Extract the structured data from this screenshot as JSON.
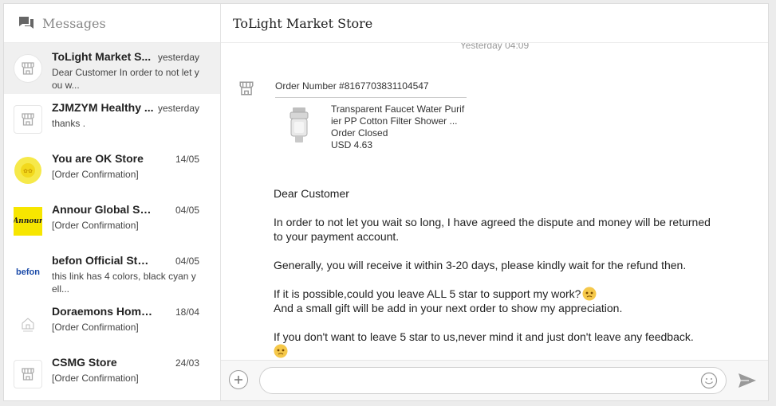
{
  "sidebar": {
    "title": "Messages",
    "icon": "chat-bubbles-icon",
    "conversations": [
      {
        "name": "ToLight Market S...",
        "date": "yesterday",
        "preview": "Dear Customer In order to not let you w...",
        "avatar": "store-icon",
        "active": true
      },
      {
        "name": "ZJMZYM Healthy ...",
        "date": "yesterday",
        "preview": "thanks .",
        "avatar": "store-icon"
      },
      {
        "name": "You are OK Store",
        "date": "14/05",
        "preview": "[Order Confirmation]",
        "avatar": "yellow-logo"
      },
      {
        "name": "Annour Global Store",
        "date": "04/05",
        "preview": "[Order Confirmation]",
        "avatar": "annour-logo",
        "logo_text": "Annour"
      },
      {
        "name": "befon Official Store",
        "date": "04/05",
        "preview": "this link has 4 colors, black cyan yell...",
        "avatar": "befon-logo",
        "logo_text": "befon"
      },
      {
        "name": "Doraemons Homes ...",
        "date": "18/04",
        "preview": "[Order Confirmation]",
        "avatar": "doraemons-logo"
      },
      {
        "name": "CSMG Store",
        "date": "24/03",
        "preview": "[Order Confirmation]",
        "avatar": "store-icon"
      }
    ]
  },
  "chat": {
    "title": "ToLight Market Store",
    "timestamp": "Yesterday 04:09",
    "order": {
      "number": "Order Number #8167703831104547",
      "product_name": "Transparent Faucet Water Purifier PP Cotton Filter Shower ...",
      "status": "Order Closed",
      "price": "USD 4.63"
    },
    "message": {
      "p1": "Dear Customer",
      "p2": "In order to not let you wait so long, I have agreed the dispute and money will be returned to your payment account.",
      "p3": "Generally, you will receive it within 3-20 days, please kindly wait for the refund then.",
      "p4a": "If it is possible,could you leave ALL 5 star to support my work?",
      "p4b": "And a small gift will be add in your next order to show my appreciation.",
      "p5": "If you don't want to leave 5 star to us,never mind it and just don't leave any feedback."
    }
  },
  "composer": {
    "placeholder": "",
    "icons": [
      "plus-icon",
      "smile-icon",
      "send-icon"
    ]
  },
  "colors": {
    "active_row": "#f0f0f0",
    "annour_yellow": "#f7e600",
    "befon_blue": "#1a4aa8",
    "emoji_yellow": "#f5c84a"
  }
}
